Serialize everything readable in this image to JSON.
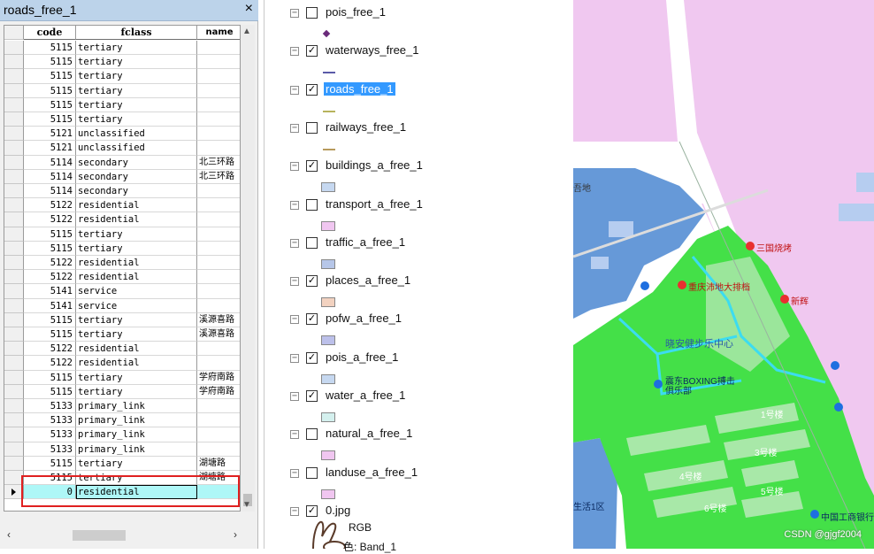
{
  "table": {
    "title": "roads_free_1",
    "close_glyph": "×",
    "columns": [
      "code",
      "fclass",
      "name"
    ],
    "rows": [
      {
        "code": "5115",
        "fclass": "tertiary",
        "name": ""
      },
      {
        "code": "5115",
        "fclass": "tertiary",
        "name": ""
      },
      {
        "code": "5115",
        "fclass": "tertiary",
        "name": ""
      },
      {
        "code": "5115",
        "fclass": "tertiary",
        "name": ""
      },
      {
        "code": "5115",
        "fclass": "tertiary",
        "name": ""
      },
      {
        "code": "5115",
        "fclass": "tertiary",
        "name": ""
      },
      {
        "code": "5121",
        "fclass": "unclassified",
        "name": ""
      },
      {
        "code": "5121",
        "fclass": "unclassified",
        "name": ""
      },
      {
        "code": "5114",
        "fclass": "secondary",
        "name": "北三环路"
      },
      {
        "code": "5114",
        "fclass": "secondary",
        "name": "北三环路"
      },
      {
        "code": "5114",
        "fclass": "secondary",
        "name": ""
      },
      {
        "code": "5122",
        "fclass": "residential",
        "name": ""
      },
      {
        "code": "5122",
        "fclass": "residential",
        "name": ""
      },
      {
        "code": "5115",
        "fclass": "tertiary",
        "name": ""
      },
      {
        "code": "5115",
        "fclass": "tertiary",
        "name": ""
      },
      {
        "code": "5122",
        "fclass": "residential",
        "name": ""
      },
      {
        "code": "5122",
        "fclass": "residential",
        "name": ""
      },
      {
        "code": "5141",
        "fclass": "service",
        "name": ""
      },
      {
        "code": "5141",
        "fclass": "service",
        "name": ""
      },
      {
        "code": "5115",
        "fclass": "tertiary",
        "name": "溪源喜路"
      },
      {
        "code": "5115",
        "fclass": "tertiary",
        "name": "溪源喜路"
      },
      {
        "code": "5122",
        "fclass": "residential",
        "name": ""
      },
      {
        "code": "5122",
        "fclass": "residential",
        "name": ""
      },
      {
        "code": "5115",
        "fclass": "tertiary",
        "name": "学府南路"
      },
      {
        "code": "5115",
        "fclass": "tertiary",
        "name": "学府南路"
      },
      {
        "code": "5133",
        "fclass": "primary_link",
        "name": ""
      },
      {
        "code": "5133",
        "fclass": "primary_link",
        "name": ""
      },
      {
        "code": "5133",
        "fclass": "primary_link",
        "name": ""
      },
      {
        "code": "5133",
        "fclass": "primary_link",
        "name": ""
      },
      {
        "code": "5115",
        "fclass": "tertiary",
        "name": "湖塘路"
      },
      {
        "code": "5115",
        "fclass": "tertiary",
        "name": "湖塘路"
      },
      {
        "code": "0",
        "fclass": "residential",
        "name": "",
        "selected": true
      }
    ]
  },
  "layers": [
    {
      "label": "pois_free_1",
      "checked": false,
      "symbol": "dot",
      "color": "#6a2a7a"
    },
    {
      "label": "waterways_free_1",
      "checked": true,
      "symbol": "line",
      "color": "#5a5aa8"
    },
    {
      "label": "roads_free_1",
      "checked": true,
      "symbol": "line",
      "color": "#b7b35c",
      "highlighted": true
    },
    {
      "label": "railways_free_1",
      "checked": false,
      "symbol": "line",
      "color": "#b79a5c"
    },
    {
      "label": "buildings_a_free_1",
      "checked": true,
      "symbol": "box",
      "color": "#c6d8f0"
    },
    {
      "label": "transport_a_free_1",
      "checked": false,
      "symbol": "box",
      "color": "#f0c6f0"
    },
    {
      "label": "traffic_a_free_1",
      "checked": false,
      "symbol": "box",
      "color": "#b6c6e8"
    },
    {
      "label": "places_a_free_1",
      "checked": true,
      "symbol": "box",
      "color": "#f2d2c0"
    },
    {
      "label": "pofw_a_free_1",
      "checked": true,
      "symbol": "box",
      "color": "#bcc0ea"
    },
    {
      "label": "pois_a_free_1",
      "checked": true,
      "symbol": "box",
      "color": "#c6d8f0"
    },
    {
      "label": "water_a_free_1",
      "checked": true,
      "symbol": "box",
      "color": "#d4f0ee"
    },
    {
      "label": "natural_a_free_1",
      "checked": false,
      "symbol": "box",
      "color": "#f0c6f0"
    },
    {
      "label": "landuse_a_free_1",
      "checked": false,
      "symbol": "box",
      "color": "#f0c6f0"
    },
    {
      "label": "0.jpg",
      "checked": true,
      "symbol": "none",
      "color": ""
    }
  ],
  "raster": {
    "rgb_label": "RGB",
    "band_label": "色: Band_1"
  },
  "map": {
    "labels": {
      "left_edge": "吾地",
      "sanguo": "三国烧烤",
      "hotel": "重庆沛地大排档",
      "xinhai": "新辉",
      "park": "晓安健步乐中心",
      "boxing": "震东BOXING搏击俱乐部",
      "b1": "1号楼",
      "b3": "3号楼",
      "b4": "4号楼",
      "b5": "5号楼",
      "b6": "6号楼",
      "xuefu": "生活1区",
      "bank": "中国工商银行"
    },
    "watermark": "CSDN @gjgf2004"
  },
  "colors": {
    "title_bar": "#bcd3ea",
    "selected_row": "#aef7f7",
    "red_frame": "#e02020",
    "highlight": "#3399ff",
    "landuse": "#f0c8f0",
    "park": "#44e048",
    "water": "#6699d8"
  }
}
